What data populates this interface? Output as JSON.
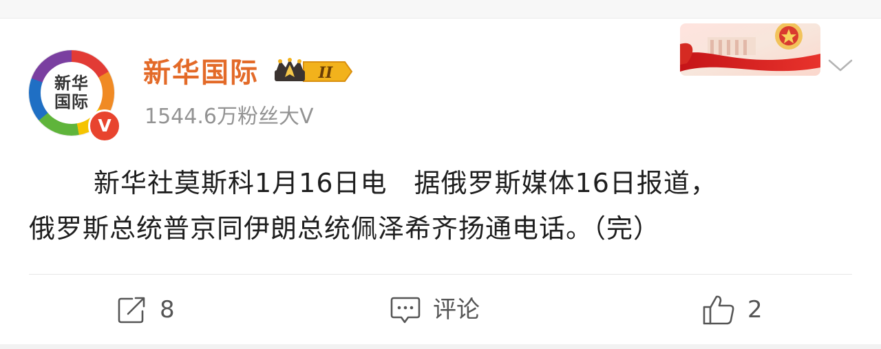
{
  "account": {
    "avatar_text": "新华国际",
    "verified_mark": "V",
    "name": "新华国际",
    "rank_level": "II",
    "followers": "1544.6万粉丝大V"
  },
  "post": {
    "line1": "新华社莫斯科1月16日电　据俄罗斯媒体16日报道，",
    "line2": "俄罗斯总统普京同伊朗总统佩泽希齐扬通电话。（完）"
  },
  "actions": {
    "repost_count": "8",
    "comment_label": "评论",
    "like_count": "2"
  },
  "colors": {
    "name": "#e36a28",
    "verified": "#e8442e",
    "muted": "#939393",
    "text": "#1e1e1e"
  },
  "icons": [
    "rank-crown-icon",
    "chevron-down-icon",
    "repost-icon",
    "comment-icon",
    "like-icon"
  ]
}
